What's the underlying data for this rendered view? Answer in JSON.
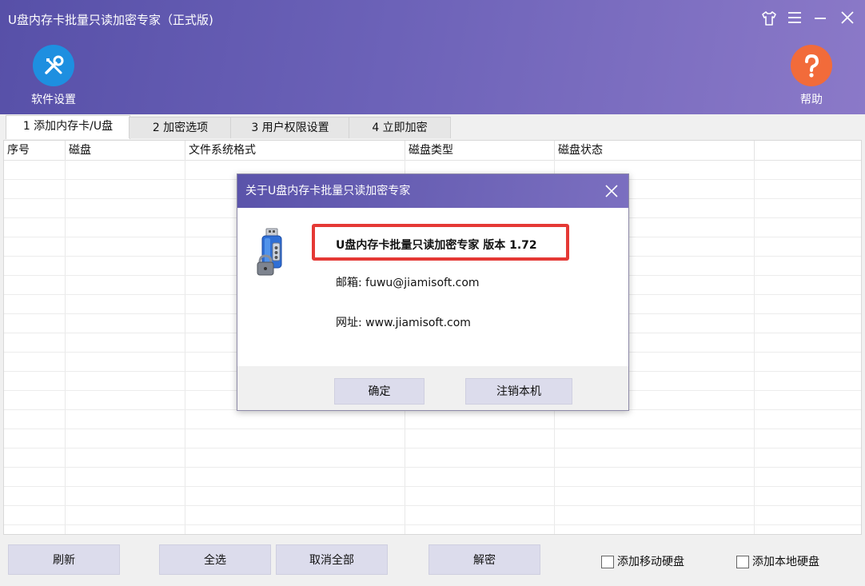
{
  "window": {
    "title": "U盘内存卡批量只读加密专家（正式版)",
    "controls": [
      "shirt-icon",
      "menu-icon",
      "minimize-icon",
      "close-icon"
    ]
  },
  "toolbar": {
    "settings_label": "软件设置",
    "help_label": "帮助",
    "settings_icon": "tools-icon",
    "help_icon": "question-icon",
    "help_color": "#f26b3a",
    "settings_color": "#1e8fe0"
  },
  "tabs": [
    {
      "label": "1 添加内存卡/U盘",
      "active": true
    },
    {
      "label": "2 加密选项",
      "active": false
    },
    {
      "label": "3 用户权限设置",
      "active": false
    },
    {
      "label": "4 立即加密",
      "active": false
    }
  ],
  "table": {
    "columns": [
      "序号",
      "磁盘",
      "文件系统格式",
      "磁盘类型",
      "磁盘状态"
    ],
    "rows": []
  },
  "buttons": {
    "refresh": "刷新",
    "select_all": "全选",
    "deselect_all": "取消全部",
    "decrypt": "解密"
  },
  "checkboxes": {
    "add_removable": "添加移动硬盘",
    "add_local": "添加本地硬盘"
  },
  "dialog": {
    "title": "关于U盘内存卡批量只读加密专家",
    "product_version": "U盘内存卡批量只读加密专家 版本 1.72",
    "email": "邮箱:  fuwu@jiamisoft.com",
    "website": "网址:  www.jiamisoft.com",
    "ok_button": "确定",
    "deregister_button": "注销本机",
    "icon": "usb-lock-icon",
    "highlight_color": "#e53935"
  }
}
